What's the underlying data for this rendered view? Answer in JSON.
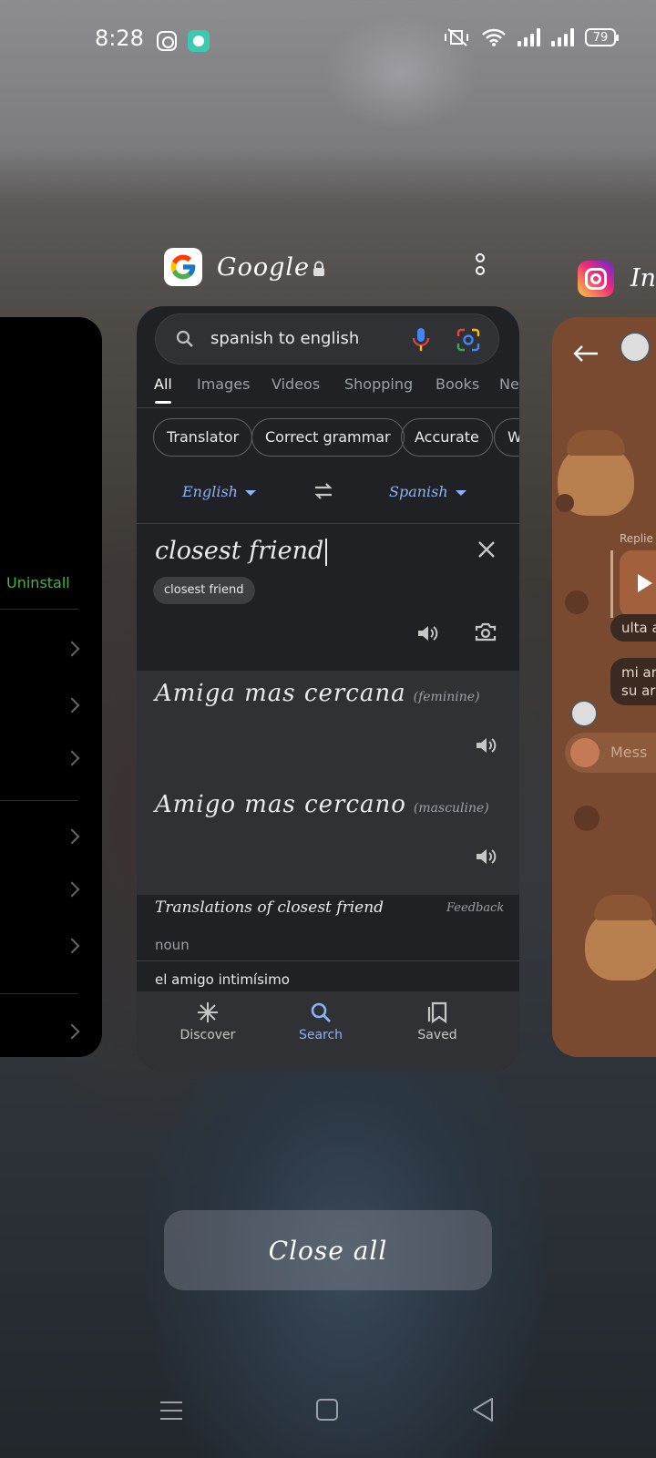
{
  "status_bar": {
    "time": "8:28",
    "battery": "79"
  },
  "left_card": {
    "action_label": "Uninstall"
  },
  "google_card": {
    "app_name": "Google",
    "search": {
      "query": "spanish to english"
    },
    "tabs": [
      "All",
      "Images",
      "Videos",
      "Shopping",
      "Books",
      "Ne"
    ],
    "chips": [
      "Translator",
      "Correct grammar",
      "Accurate",
      "W"
    ],
    "source_lang": "English",
    "target_lang": "Spanish",
    "input_text": "closest friend",
    "suggestion": "closest friend",
    "translations": [
      {
        "text": "Amiga mas cercana",
        "gender": "(feminine)"
      },
      {
        "text": "Amigo mas cercano",
        "gender": "(masculine)"
      }
    ],
    "translations_heading": "Translations of closest friend",
    "feedback_label": "Feedback",
    "part_of_speech": "noun",
    "first_entry": "el amigo intimísimo",
    "bottom_nav": [
      {
        "label": "Discover",
        "icon": "asterisk-icon"
      },
      {
        "label": "Search",
        "icon": "search-icon"
      },
      {
        "label": "Saved",
        "icon": "bookmark-icon"
      }
    ]
  },
  "instagram_card": {
    "app_name_partial": "Ins",
    "replied_label": "Replie",
    "bubbles": [
      "ulta a",
      "mi ar",
      "su ar"
    ],
    "message_placeholder": "Mess"
  },
  "close_all_label": "Close all",
  "colors": {
    "accent_blue": "#8ab4f8",
    "card_bg": "#202124",
    "uninstall_green": "#4caf50"
  }
}
